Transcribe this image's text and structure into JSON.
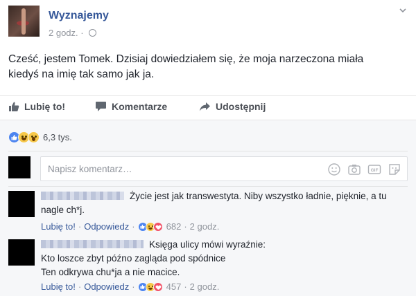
{
  "post": {
    "page_name": "Wyznajemy",
    "time": "2 godz.",
    "separator": "·",
    "text": "Cześć, jestem Tomek. Dzisiaj dowiedziałem się, że moja narzeczona miała kiedyś na imię tak samo jak ja."
  },
  "actions": {
    "like": "Lubię to!",
    "comment": "Komentarze",
    "share": "Udostępnij"
  },
  "reactions": {
    "icons": [
      "like",
      "haha",
      "wow"
    ],
    "count": "6,3 tys."
  },
  "composer": {
    "placeholder": "Napisz komentarz…",
    "icons": [
      "emoji-icon",
      "camera-icon",
      "gif-icon",
      "sticker-icon"
    ]
  },
  "comments": [
    {
      "text": "Życie jest jak transwestyta. Niby wszystko ładnie, pięknie, a tu nagle ch*j.",
      "like_label": "Lubię to!",
      "reply_label": "Odpowiedz",
      "reaction_icons": [
        "like",
        "haha",
        "love"
      ],
      "reaction_count": "682",
      "time": "2 godz."
    },
    {
      "text_lines": [
        "Księga ulicy mówi wyraźnie:",
        "Kto loszce zbyt późno zagląda pod spódnice",
        "Ten odkrywa chu*ja a nie macice."
      ],
      "like_label": "Lubię to!",
      "reply_label": "Odpowiedz",
      "reaction_icons": [
        "like",
        "haha",
        "love"
      ],
      "reaction_count": "457",
      "time": "2 godz."
    }
  ],
  "colors": {
    "link": "#365899",
    "muted": "#90949c",
    "text": "#1d2129",
    "action_text": "#4b4f56",
    "comments_bg": "#f6f7f9"
  }
}
